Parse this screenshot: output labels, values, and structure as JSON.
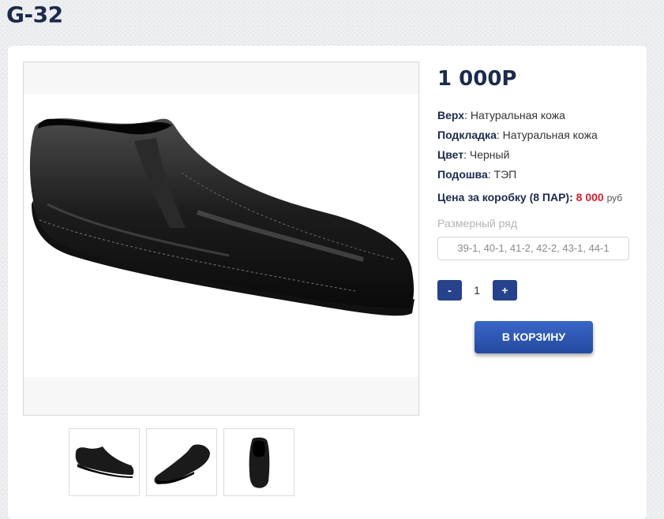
{
  "product": {
    "title": "G-32",
    "price": "1 000Р",
    "specs": [
      {
        "label": "Верх",
        "value": "Натуральная кожа"
      },
      {
        "label": "Подкладка",
        "value": "Натуральная кожа"
      },
      {
        "label": "Цвет",
        "value": "Черный"
      },
      {
        "label": "Подошва",
        "value": "ТЭП"
      }
    ],
    "box_price": {
      "label": "Цена за коробку (8 ПАР):",
      "value": "8 000",
      "currency": "руб"
    }
  },
  "size": {
    "label": "Размерный ряд",
    "value": "39-1, 40-1, 41-2, 42-2, 43-1, 44-1"
  },
  "quantity": {
    "minus": "-",
    "value": "1",
    "plus": "+"
  },
  "cart_button": "В КОРЗИНУ",
  "colors": {
    "accent": "#26428b",
    "title": "#1d2a4c",
    "price_red": "#d4202c"
  },
  "icons": {
    "main_image": "black-leather-slip-on-shoe",
    "thumbnails": [
      "shoe-side-view",
      "shoe-angle-view",
      "shoe-top-view"
    ]
  }
}
